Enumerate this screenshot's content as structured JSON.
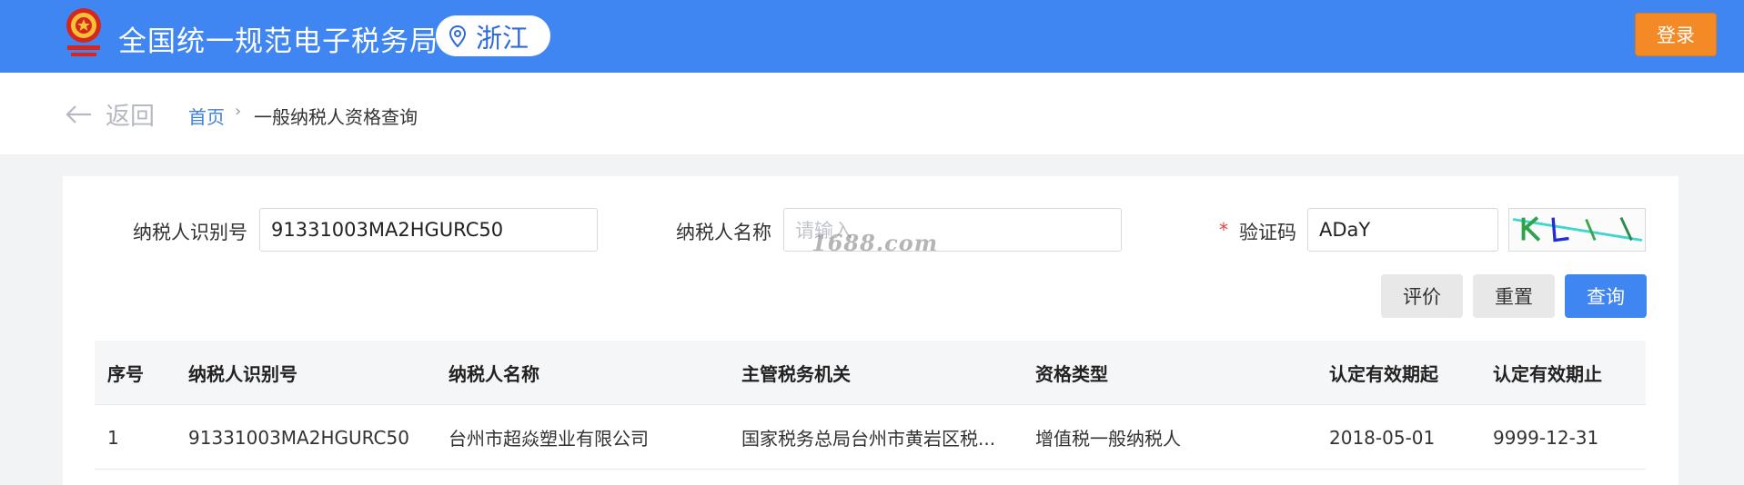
{
  "header": {
    "site_title": "全国统一规范电子税务局",
    "province": "浙江",
    "login_label": "登录"
  },
  "breadcrumb": {
    "back_label": "返回",
    "home": "首页",
    "separator": "›",
    "current": "一般纳税人资格查询"
  },
  "form": {
    "taxpayer_id_label": "纳税人识别号",
    "taxpayer_id_value": "91331003MA2HGURC50",
    "taxpayer_name_label": "纳税人名称",
    "taxpayer_name_placeholder": "请输入",
    "captcha_label": "验证码",
    "captcha_required_mark": "*",
    "captcha_value": "ADaY",
    "watermark": "1688.com"
  },
  "buttons": {
    "evaluate": "评价",
    "reset": "重置",
    "search": "查询"
  },
  "table": {
    "headers": [
      "序号",
      "纳税人识别号",
      "纳税人名称",
      "主管税务机关",
      "资格类型",
      "认定有效期起",
      "认定有效期止"
    ],
    "rows": [
      [
        "1",
        "91331003MA2HGURC50",
        "台州市超焱塑业有限公司",
        "国家税务总局台州市黄岩区税...",
        "增值税一般纳税人",
        "2018-05-01",
        "9999-12-31"
      ]
    ]
  },
  "colors": {
    "header_blue": "#3f86f3",
    "login_orange": "#f38a26",
    "link_blue": "#3f7fd9",
    "required_red": "#e2413b"
  }
}
